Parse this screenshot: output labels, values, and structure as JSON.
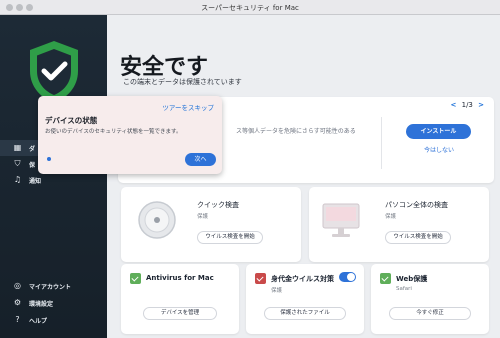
{
  "window": {
    "title": "スーパーセキュリティ for Mac"
  },
  "sidebar": {
    "items": [
      {
        "label": "ダ",
        "icon": "dashboard-icon"
      },
      {
        "label": "保",
        "icon": "shield-icon"
      },
      {
        "label": "通知",
        "icon": "bell-icon"
      }
    ],
    "bottom": [
      {
        "label": "マイアカウント",
        "icon": "account-icon"
      },
      {
        "label": "環境設定",
        "icon": "gear-icon"
      },
      {
        "label": "ヘルプ",
        "icon": "help-icon"
      }
    ]
  },
  "hero": {
    "title": "安全です",
    "subtitle": "この端末とデータは保護されています"
  },
  "banner": {
    "pager": "1/3",
    "text": "ス等個人データを危険にさらす可能性のある",
    "install": "インストール",
    "later": "今はしない"
  },
  "cards": {
    "quick_scan": {
      "title": "クイック検査",
      "status": "保護",
      "button": "ウイルス検査を開始"
    },
    "full_scan": {
      "title": "パソコン全体の検査",
      "status": "保護",
      "button": "ウイルス検査を開始"
    },
    "antivirus": {
      "title": "Antivirus for Mac",
      "button": "デバイスを管理"
    },
    "ransomware": {
      "title": "身代金ウイルス対策",
      "status": "保護",
      "button": "保護されたファイル"
    },
    "web": {
      "title": "Web保護",
      "status": "Safari",
      "button": "今すぐ修正"
    }
  },
  "tour": {
    "skip": "ツアーをスキップ",
    "title": "デバイスの状態",
    "body": "お使いのデバイスのセキュリティ状態を一覧できます。",
    "next": "次へ"
  },
  "colors": {
    "accent": "#2e72d8",
    "shield_green": "#2f9e48",
    "sidebar_bg": "#1d2a36"
  }
}
